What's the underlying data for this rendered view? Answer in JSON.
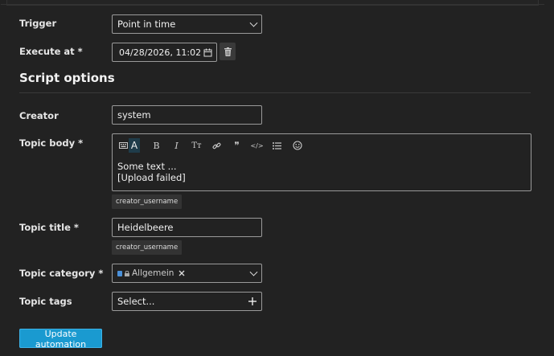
{
  "form": {
    "trigger": {
      "label": "Trigger",
      "value": "Point in time"
    },
    "execute_at": {
      "label": "Execute at *",
      "month": "04",
      "day": "28",
      "year": "2026",
      "time": "11:02",
      "delete_icon": "trash-icon"
    }
  },
  "script_options": {
    "title": "Script options",
    "creator": {
      "label": "Creator",
      "value": "system"
    },
    "topic_body": {
      "label": "Topic body *",
      "toolbar": [
        {
          "name": "toggle-rich-editor",
          "icon": "keyboard-icon"
        },
        {
          "name": "bold",
          "glyph": "B"
        },
        {
          "name": "italic",
          "glyph": "I"
        },
        {
          "name": "heading",
          "glyph": "Tт"
        },
        {
          "name": "link",
          "icon": "link-icon"
        },
        {
          "name": "quote",
          "glyph": "❞"
        },
        {
          "name": "code",
          "glyph": "</>"
        },
        {
          "name": "bullet-list",
          "icon": "list-icon"
        },
        {
          "name": "emoji",
          "icon": "smile-icon"
        }
      ],
      "line1": "Some text ...",
      "line2": "[Upload failed]",
      "placeholder_chip": "creator_username"
    },
    "topic_title": {
      "label": "Topic title *",
      "value": "Heidelbeere",
      "placeholder_chip": "creator_username"
    },
    "topic_category": {
      "label": "Topic category *",
      "value": "Allgemein",
      "color": "#4a90d9"
    },
    "topic_tags": {
      "label": "Topic tags",
      "placeholder": "Select..."
    }
  },
  "actions": {
    "update_label": "Update automation"
  },
  "colors": {
    "primary": "#1a9ad0",
    "background": "#222222"
  }
}
